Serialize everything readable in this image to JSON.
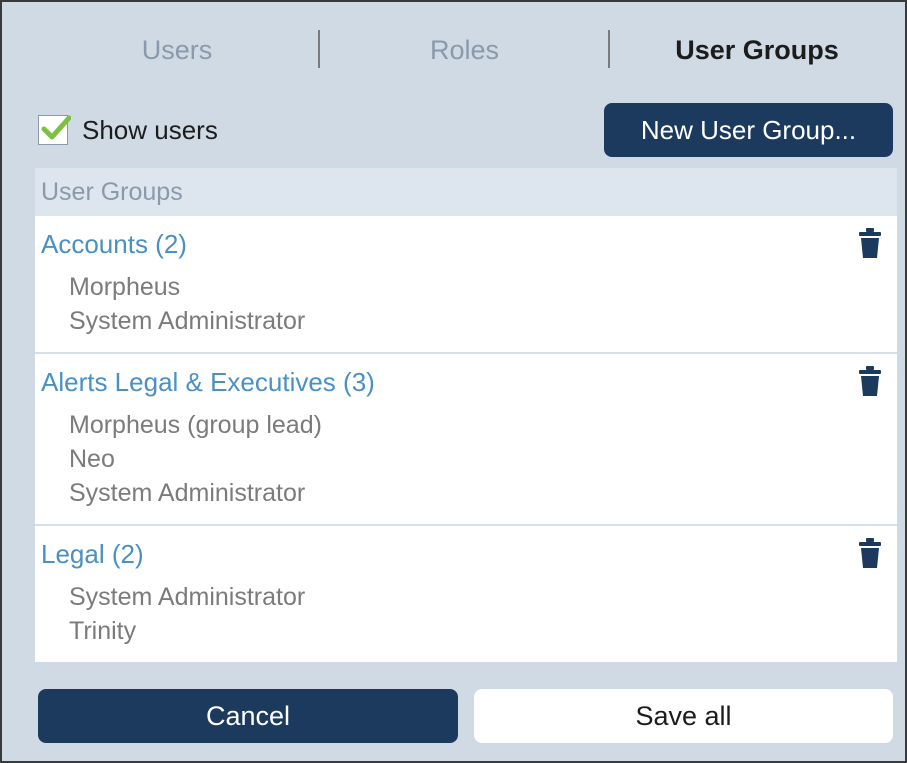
{
  "tabs": [
    {
      "label": "Users",
      "active": false
    },
    {
      "label": "Roles",
      "active": false
    },
    {
      "label": "User Groups",
      "active": true
    }
  ],
  "toolbar": {
    "show_users_label": "Show users",
    "show_users_checked": true,
    "new_group_label": "New User Group..."
  },
  "list": {
    "header": "User Groups",
    "groups": [
      {
        "title": "Accounts (2)",
        "members": [
          "Morpheus",
          "System Administrator"
        ],
        "delete_icon": "trash-icon"
      },
      {
        "title": "Alerts Legal & Executives (3)",
        "members": [
          "Morpheus (group lead)",
          "Neo",
          "System Administrator"
        ],
        "delete_icon": "trash-icon"
      },
      {
        "title": "Legal (2)",
        "members": [
          "System Administrator",
          "Trinity"
        ],
        "delete_icon": "trash-icon"
      }
    ]
  },
  "footer": {
    "cancel_label": "Cancel",
    "save_label": "Save all"
  },
  "colors": {
    "panel_bg": "#cfdae5",
    "primary_button": "#1b3a5e",
    "group_title": "#4a90c2",
    "check_green": "#7dc142"
  }
}
